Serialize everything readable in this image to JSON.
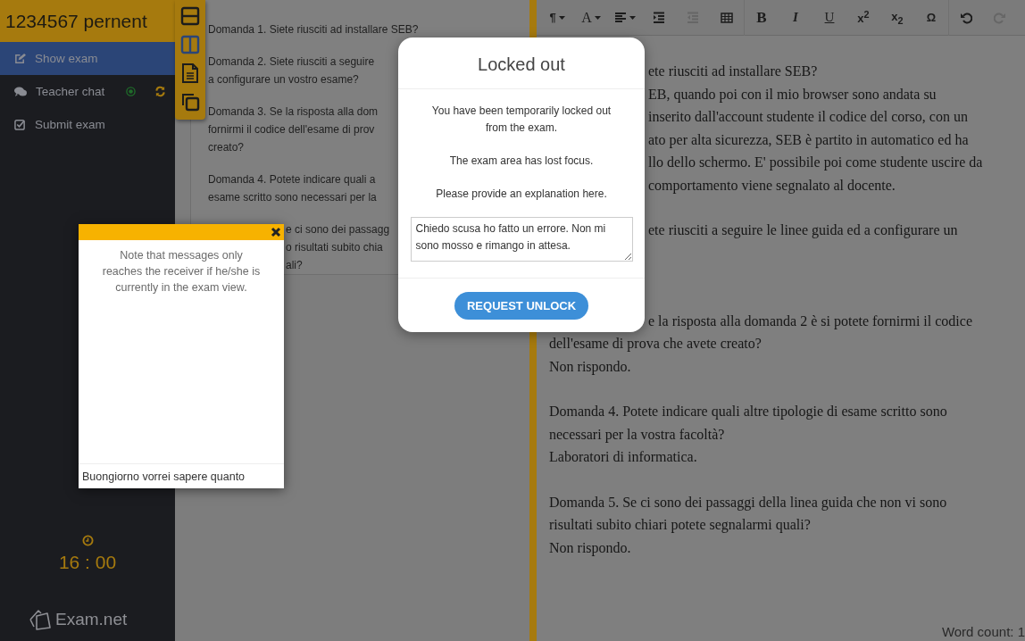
{
  "sidebar": {
    "title": "1234567 pernent",
    "items": [
      {
        "kind": "edit",
        "label": "Show exam",
        "selected": true
      },
      {
        "kind": "chat",
        "label": "Teacher chat",
        "selected": false
      },
      {
        "kind": "submit",
        "label": "Submit exam",
        "selected": false
      }
    ],
    "timer": "16 : 00",
    "logo": "Exam.net"
  },
  "layout_tools": [
    {
      "kind": "stacked",
      "selected": false
    },
    {
      "kind": "side-by-side",
      "selected": true
    },
    {
      "kind": "document",
      "selected": false
    },
    {
      "kind": "windows",
      "selected": false
    }
  ],
  "questions": [
    {
      "lines": [
        "Domanda 1. Siete riusciti ad installare SEB?"
      ]
    },
    {
      "lines": [
        "Domanda 2. Siete riusciti a seguire",
        "a configurare un vostro esame?"
      ]
    },
    {
      "lines": [
        "Domanda 3. Se la risposta alla dom",
        "fornirmi il codice dell'esame di prov",
        "creato?"
      ]
    },
    {
      "lines": [
        "Domanda 4. Potete indicare quali a",
        "esame scritto sono necessari per la"
      ]
    },
    {
      "lines": [
        "e ci sono dei passagg",
        "o risultati subito chia",
        "ali?"
      ]
    }
  ],
  "editor": {
    "toolbar": [
      [
        {
          "kind": "paragraph",
          "label": "¶",
          "dropdown": true,
          "disabled": false
        },
        {
          "kind": "font",
          "label": "A",
          "dropdown": true,
          "disabled": false
        },
        {
          "kind": "align",
          "dropdown": true,
          "disabled": false
        },
        {
          "kind": "indent",
          "dropdown": false,
          "disabled": false
        },
        {
          "kind": "outdent",
          "dropdown": false,
          "disabled": true
        },
        {
          "kind": "table",
          "dropdown": false,
          "disabled": false
        }
      ],
      [
        {
          "kind": "bold",
          "label": "B",
          "dropdown": false,
          "disabled": false
        },
        {
          "kind": "italic",
          "label": "I",
          "dropdown": false,
          "disabled": false
        },
        {
          "kind": "underline",
          "label": "U",
          "dropdown": false,
          "disabled": false
        },
        {
          "kind": "superscript",
          "label": "x$^{2}$",
          "dropdown": false,
          "disabled": false
        },
        {
          "kind": "subscript",
          "label": "x$_{2}$",
          "dropdown": false,
          "disabled": false
        },
        {
          "kind": "symbol",
          "label": "Ω",
          "dropdown": false,
          "disabled": false
        }
      ],
      [
        {
          "kind": "undo",
          "dropdown": false,
          "disabled": false
        },
        {
          "kind": "redo",
          "dropdown": false,
          "disabled": true
        }
      ]
    ],
    "paragraphs": [
      {
        "lines": [
          "ete riusciti ad installare SEB?",
          "EB, quando poi con il mio browser sono andata su",
          "inserito dall'account studente il codice del corso, con un",
          "ato per alta sicurezza, SEB è partito in automatico ed ha",
          "llo dello schermo. E' possibile poi come studente uscire da",
          "comportamento viene segnalato al docente."
        ]
      },
      {
        "lines": [
          "ete riusciti a seguire le linee guida ed a configurare un"
        ]
      },
      {
        "lines": [
          "e la risposta alla domanda 2 è si potete fornirmi il codice",
          "dell'esame di prova che avete creato?",
          "Non rispondo."
        ]
      },
      {
        "lines": [
          "Domanda 4. Potete indicare quali altre tipologie di esame scritto sono",
          "necessari per la vostra facoltà?",
          "Laboratori di informatica."
        ]
      },
      {
        "lines": [
          "Domanda 5. Se ci sono dei passaggi della linea guida che non vi sono",
          "risultati subito chiari potete segnalarmi quali?",
          "Non rispondo."
        ]
      }
    ],
    "word_count": "Word count: 1"
  },
  "chat_popup": {
    "note": "Note that messages only reaches the receiver if he/she is currently in the exam view.",
    "input": {
      "value": "Buongiorno vorrei sapere quanto"
    }
  },
  "dialog": {
    "title": "Locked out",
    "messages": [
      "You have been temporarily locked out from the exam.",
      "The exam area has lost focus.",
      "Please provide an explanation here."
    ],
    "explanation": {
      "value": "Chiedo scusa ho fatto un errore. Non mi sono mosso e rimango in attesa."
    },
    "button": "REQUEST UNLOCK"
  }
}
